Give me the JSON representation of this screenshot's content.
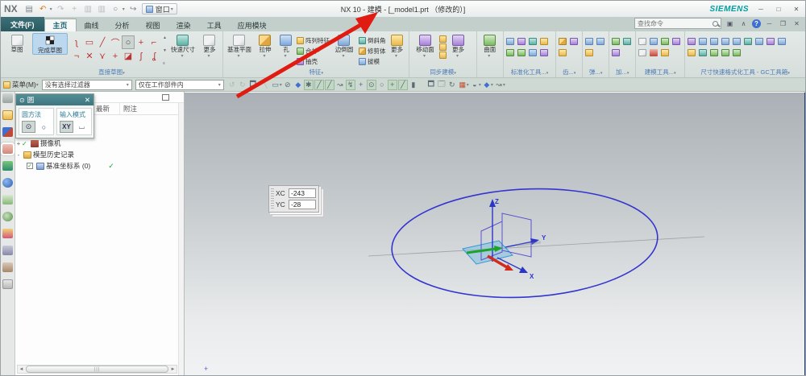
{
  "window": {
    "title": "NX 10 - 建模 - [_model1.prt （修改的）]",
    "brand": "SIEMENS",
    "logo": "NX",
    "controls": {
      "minimize": "─",
      "maximize": "□",
      "close": "✕"
    }
  },
  "quick_access": {
    "window_button": "窗口"
  },
  "tabs": {
    "file": "文件(F)",
    "items": [
      "主页",
      "曲线",
      "分析",
      "视图",
      "渲染",
      "工具",
      "应用模块"
    ],
    "active": "主页"
  },
  "search": {
    "placeholder": "查找命令"
  },
  "ribbon": {
    "direct_sketch": {
      "label": "直接草图",
      "sketch": "草图",
      "finish_sketch": "完成草图",
      "rapid_dimension": "快速尺寸",
      "more": "更多"
    },
    "feature": {
      "label": "特征",
      "datum_plane": "基准平面",
      "extrude": "拉伸",
      "hole": "孔",
      "stack1": [
        "阵列特征",
        "合并",
        "抽壳"
      ],
      "edge_blend": "边倒圆",
      "stack2": [
        "倒斜角",
        "修剪体",
        "拔模"
      ],
      "more": "更多"
    },
    "synchronous": {
      "label": "同步建模",
      "move_face": "移动面",
      "more": "更多"
    },
    "surface": {
      "label": "曲面",
      "surface": "曲面"
    },
    "group_labels": [
      "标准化工具...",
      "齿...",
      "弹...",
      "加...",
      "建模工具...",
      "尺寸快速格式化工具 - GC工具箱"
    ]
  },
  "menubar": {
    "menu": "菜单(M)",
    "selection_filter": "没有选择过滤器",
    "scope_filter": "仅在工作部件内"
  },
  "navigator": {
    "columns": [
      "最新",
      "附注"
    ],
    "rows": [
      {
        "expander": "+",
        "label": "摄像机"
      },
      {
        "expander": "-",
        "label": "模型历史记录"
      },
      {
        "expander": "",
        "label": "基准坐标系 (0)",
        "status": "✓"
      }
    ]
  },
  "dialog": {
    "title": "圆",
    "method_label": "圆方法",
    "input_mode_label": "输入模式",
    "xy_button": "XY"
  },
  "canvas": {
    "coord_box": {
      "x_label": "XC",
      "x_value": "-243",
      "y_label": "YC",
      "y_value": "-28"
    },
    "axis_labels": {
      "x": "X",
      "y": "Y",
      "z": "Z"
    }
  },
  "glyphs": {
    "dropdown": "▾",
    "undo": "↶",
    "redo": "↷",
    "plus": "+",
    "circle": "○",
    "check": "✓",
    "close": "✕",
    "chevron_up": "∧",
    "help": "?",
    "left": "◄",
    "right": "►",
    "grip": "|||"
  },
  "colors": {
    "brand_teal": "#00a0a0",
    "dialog_teal": "#47818c",
    "tab_strip": "#c3cfca",
    "arrow_red": "#e01b12",
    "circle_blue": "#3434d0",
    "axis_green": "#1ca32e",
    "axis_red": "#d42a1c",
    "canvas_border": "#24407e"
  }
}
